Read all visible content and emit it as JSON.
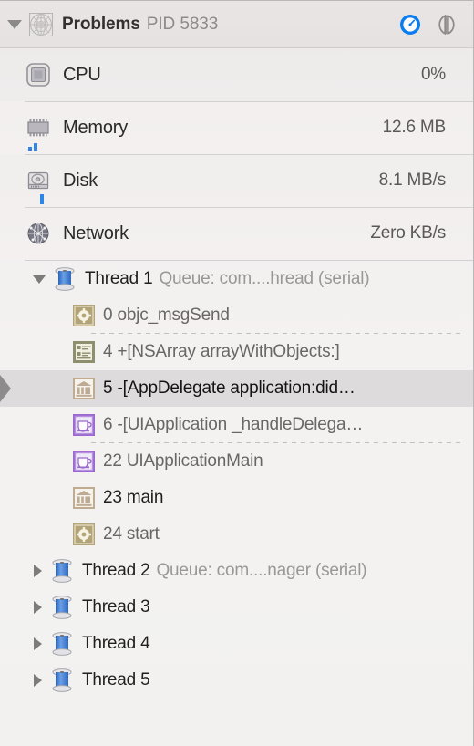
{
  "header": {
    "disclosure": "triangle-down",
    "app_icon": "wireframe-globe-icon",
    "title": "Problems",
    "pid": "PID 5833",
    "buttons": [
      {
        "name": "gauge-toggle-button",
        "icon": "gauge-icon",
        "state": "active",
        "color": "#0a7cf0"
      },
      {
        "name": "split-view-button",
        "icon": "split-view-icon",
        "state": "inactive",
        "color": "#8d8a89"
      }
    ]
  },
  "metrics": [
    {
      "icon": "cpu-chip-icon",
      "label": "CPU",
      "value": "0%",
      "spark": []
    },
    {
      "icon": "memory-ram-icon",
      "label": "Memory",
      "value": "12.6 MB",
      "spark": [
        5,
        9
      ]
    },
    {
      "icon": "disk-drive-icon",
      "label": "Disk",
      "value": "8.1 MB/s",
      "spark": [
        11
      ]
    },
    {
      "icon": "network-globe-icon",
      "label": "Network",
      "value": "Zero KB/s",
      "spark": []
    }
  ],
  "threads": [
    {
      "disclosure": "triangle-down",
      "icon": "thread-spool-icon",
      "name": "Thread 1",
      "queue": "Queue: com....hread (serial)",
      "frames": [
        {
          "icon": "gear-icon",
          "icon_color": "#b3a477",
          "text": "0 objc_msgSend",
          "selected": false,
          "dashed_below": true
        },
        {
          "icon": "list-rows-icon",
          "icon_color": "#8d8f6f",
          "text": "4 +[NSArray arrayWithObjects:]",
          "selected": false,
          "dashed_below": false
        },
        {
          "icon": "bank-icon",
          "icon_color": "#bfaa92",
          "text": "5 -[AppDelegate application:did…",
          "selected": true,
          "dashed_below": false
        },
        {
          "icon": "coffee-cup-icon",
          "icon_color": "#9a68cf",
          "text": "6 -[UIApplication _handleDelega…",
          "selected": false,
          "dashed_below": true
        },
        {
          "icon": "coffee-cup-icon",
          "icon_color": "#9a68cf",
          "text": "22 UIApplicationMain",
          "selected": false,
          "dashed_below": false
        },
        {
          "icon": "bank-icon",
          "icon_color": "#bfaa92",
          "text": "23 main",
          "selected": false,
          "dashed_below": false
        },
        {
          "icon": "gear-icon",
          "icon_color": "#b3a477",
          "text": "24 start",
          "selected": false,
          "dashed_below": false
        }
      ]
    },
    {
      "disclosure": "triangle-right",
      "icon": "thread-spool-icon",
      "name": "Thread 2",
      "queue": "Queue: com....nager (serial)",
      "frames": []
    },
    {
      "disclosure": "triangle-right",
      "icon": "thread-spool-icon",
      "name": "Thread 3",
      "queue": "",
      "frames": []
    },
    {
      "disclosure": "triangle-right",
      "icon": "thread-spool-icon",
      "name": "Thread 4",
      "queue": "",
      "frames": []
    },
    {
      "disclosure": "triangle-right",
      "icon": "thread-spool-icon",
      "name": "Thread 5",
      "queue": "",
      "frames": []
    }
  ],
  "colors": {
    "accent_blue": "#0a7cf0",
    "spark_blue": "#2e87e8",
    "selection": "#dddbdb",
    "text_primary": "#211f1e",
    "text_secondary": "#9a9796"
  }
}
